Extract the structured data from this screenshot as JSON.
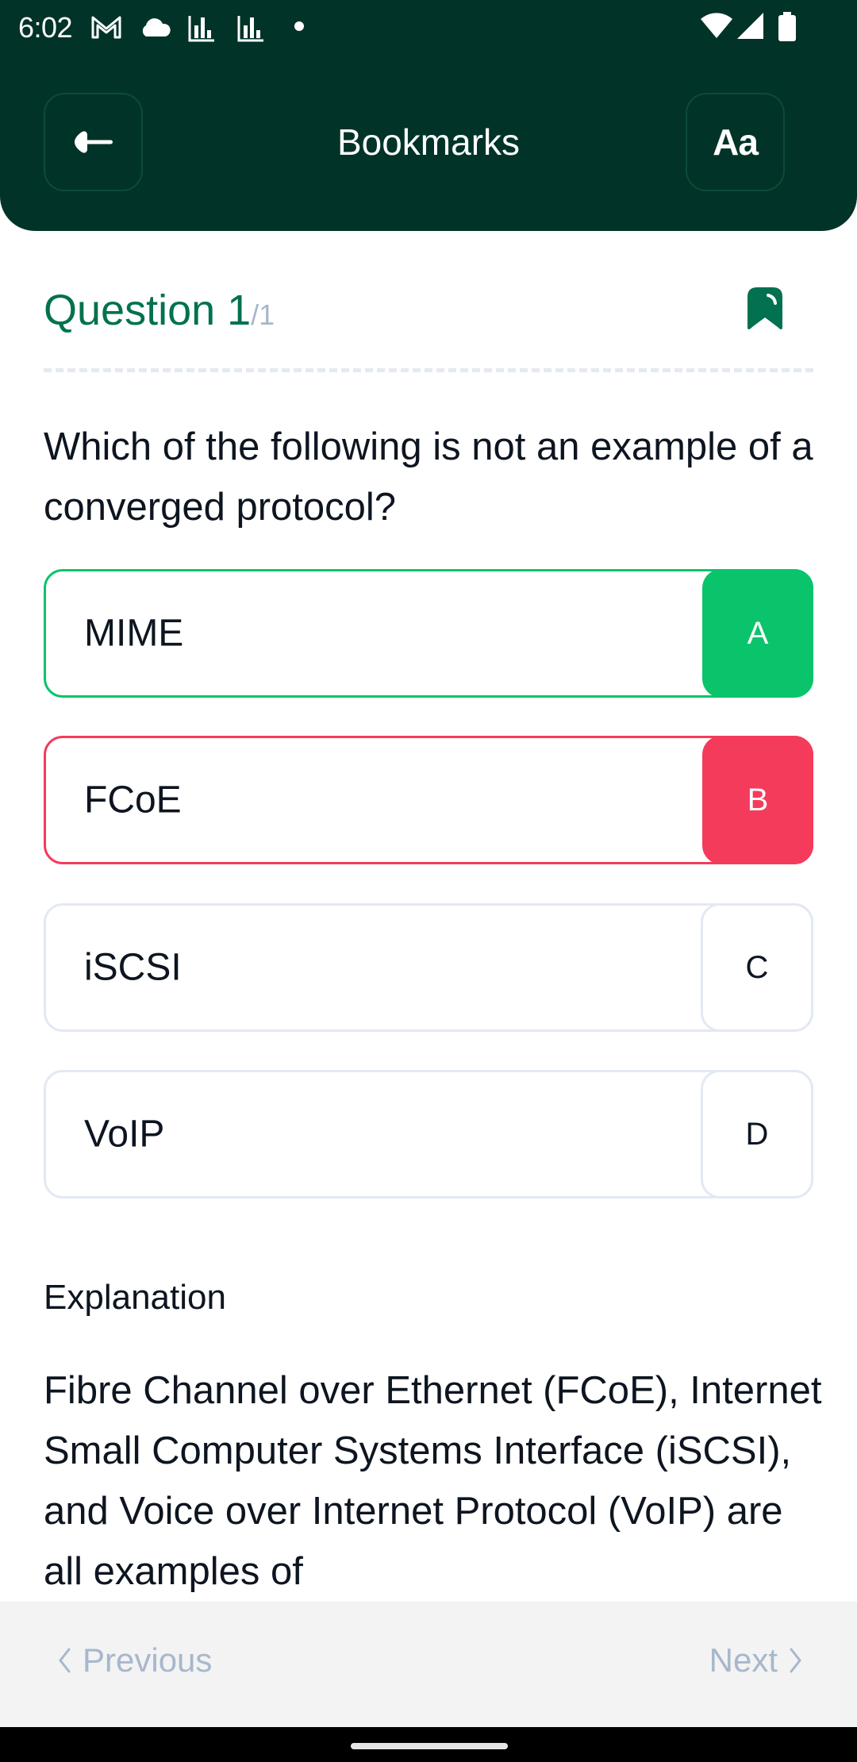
{
  "status_bar": {
    "time": "6:02",
    "left_icons": [
      "gmail-icon",
      "cloud-icon",
      "chart-icon",
      "chart-icon",
      "dot-icon"
    ],
    "right_icons": [
      "wifi-icon",
      "signal-icon",
      "battery-icon"
    ]
  },
  "header": {
    "title": "Bookmarks",
    "back_icon": "arrow-left-icon",
    "font_button_label": "Aa"
  },
  "question": {
    "label": "Question 1",
    "total": "/1",
    "bookmarked": true,
    "text": "Which of the following is not an example of a converged protocol?"
  },
  "options": [
    {
      "letter": "A",
      "text": "MIME",
      "state": "correct"
    },
    {
      "letter": "B",
      "text": "FCoE",
      "state": "wrong"
    },
    {
      "letter": "C",
      "text": "iSCSI",
      "state": "default"
    },
    {
      "letter": "D",
      "text": "VoIP",
      "state": "default"
    }
  ],
  "explanation": {
    "title": "Explanation",
    "text": "Fibre Channel over Ethernet (FCoE), Internet Small Computer Systems Interface (iSCSI), and Voice over Internet Protocol (VoIP) are all examples of"
  },
  "navigation": {
    "previous_label": "Previous",
    "next_label": "Next"
  },
  "colors": {
    "header_bg": "#013328",
    "accent": "#02714f",
    "correct": "#0ac46b",
    "wrong": "#f53b5b",
    "muted": "#a8b7cc"
  }
}
